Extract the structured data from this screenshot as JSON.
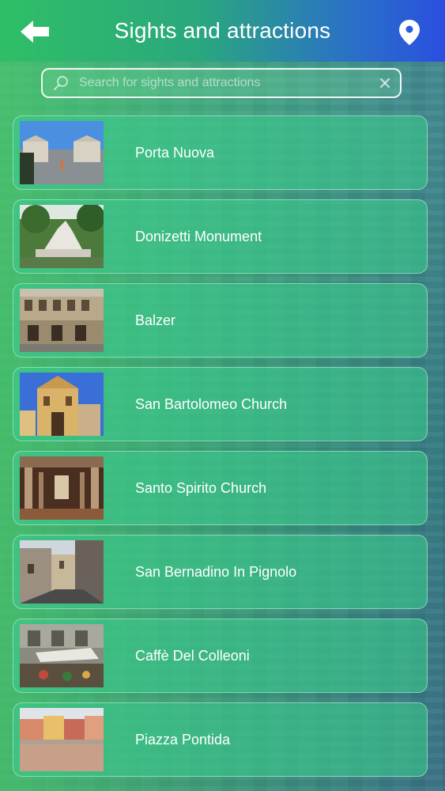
{
  "header": {
    "title": "Sights and attractions",
    "back_icon": "arrow-left-icon",
    "location_icon": "map-pin-icon",
    "gradient_start": "#2fbf66",
    "gradient_end": "#2a4fe0"
  },
  "search": {
    "placeholder": "Search for sights and attractions",
    "value": "",
    "search_icon": "magnifier-icon",
    "clear_icon": "close-icon"
  },
  "items": [
    {
      "label": "Porta Nuova"
    },
    {
      "label": "Donizetti Monument"
    },
    {
      "label": "Balzer"
    },
    {
      "label": "San Bartolomeo Church"
    },
    {
      "label": "Santo Spirito Church"
    },
    {
      "label": "San Bernadino In Pignolo"
    },
    {
      "label": "Caffè Del Colleoni"
    },
    {
      "label": "Piazza Pontida"
    }
  ],
  "colors": {
    "card_fill": "#3cc88c",
    "text": "#ffffff"
  }
}
